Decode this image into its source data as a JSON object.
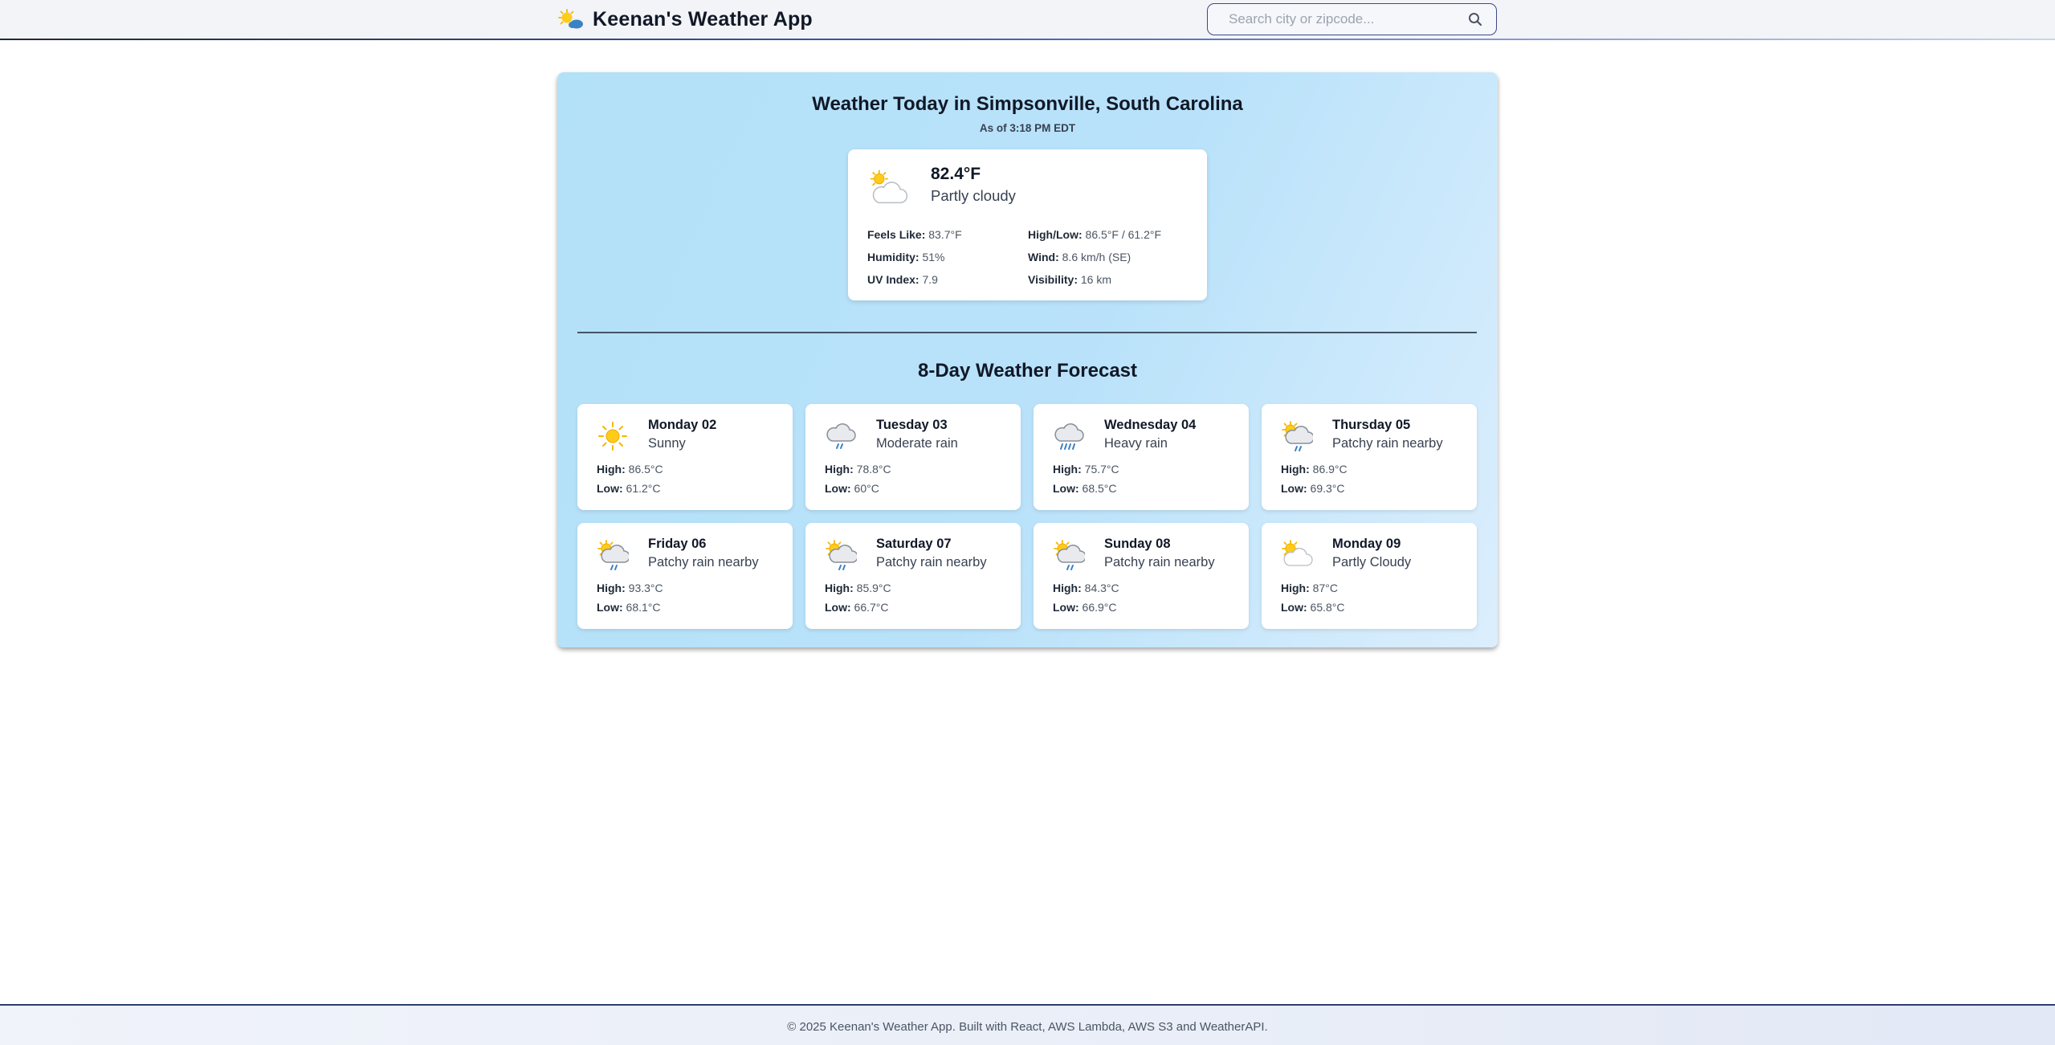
{
  "header": {
    "title": "Keenan's Weather App",
    "logo_icon": "sun-behind-cloud-icon",
    "search_placeholder": "Search city or zipcode...",
    "search_value": ""
  },
  "today": {
    "title": "Weather Today in Simpsonville, South Carolina",
    "as_of": "As of 3:18 PM EDT",
    "icon": "partly-cloudy-icon",
    "temperature": "82.4°F",
    "condition": "Partly cloudy",
    "details": [
      {
        "label": "Feels Like:",
        "value": "83.7°F"
      },
      {
        "label": "High/Low:",
        "value": "86.5°F / 61.2°F"
      },
      {
        "label": "Humidity:",
        "value": "51%"
      },
      {
        "label": "Wind:",
        "value": "8.6 km/h (SE)"
      },
      {
        "label": "UV Index:",
        "value": "7.9"
      },
      {
        "label": "Visibility:",
        "value": "16 km"
      }
    ]
  },
  "forecast": {
    "title": "8-Day Weather Forecast",
    "high_label": "High:",
    "low_label": "Low:",
    "days": [
      {
        "day": "Monday 02",
        "condition": "Sunny",
        "high": "86.5°C",
        "low": "61.2°C",
        "icon": "sunny-icon"
      },
      {
        "day": "Tuesday 03",
        "condition": "Moderate rain",
        "high": "78.8°C",
        "low": "60°C",
        "icon": "moderate-rain-icon"
      },
      {
        "day": "Wednesday 04",
        "condition": "Heavy rain",
        "high": "75.7°C",
        "low": "68.5°C",
        "icon": "heavy-rain-icon"
      },
      {
        "day": "Thursday 05",
        "condition": "Patchy rain nearby",
        "high": "86.9°C",
        "low": "69.3°C",
        "icon": "patchy-rain-icon"
      },
      {
        "day": "Friday 06",
        "condition": "Patchy rain nearby",
        "high": "93.3°C",
        "low": "68.1°C",
        "icon": "patchy-rain-icon"
      },
      {
        "day": "Saturday 07",
        "condition": "Patchy rain nearby",
        "high": "85.9°C",
        "low": "66.7°C",
        "icon": "patchy-rain-icon"
      },
      {
        "day": "Sunday 08",
        "condition": "Patchy rain nearby",
        "high": "84.3°C",
        "low": "66.9°C",
        "icon": "patchy-rain-icon"
      },
      {
        "day": "Monday 09",
        "condition": "Partly Cloudy",
        "high": "87°C",
        "low": "65.8°C",
        "icon": "partly-cloudy-icon"
      }
    ]
  },
  "footer": {
    "text": "© 2025 Keenan's Weather App. Built with React, AWS Lambda, AWS S3 and WeatherAPI."
  },
  "colors": {
    "panel_gradient_start": "#b3e1f8",
    "panel_gradient_end": "#dbeefd",
    "sun": "#f5b800",
    "rain": "#3b82c4",
    "search_border": "#3a4a86"
  }
}
